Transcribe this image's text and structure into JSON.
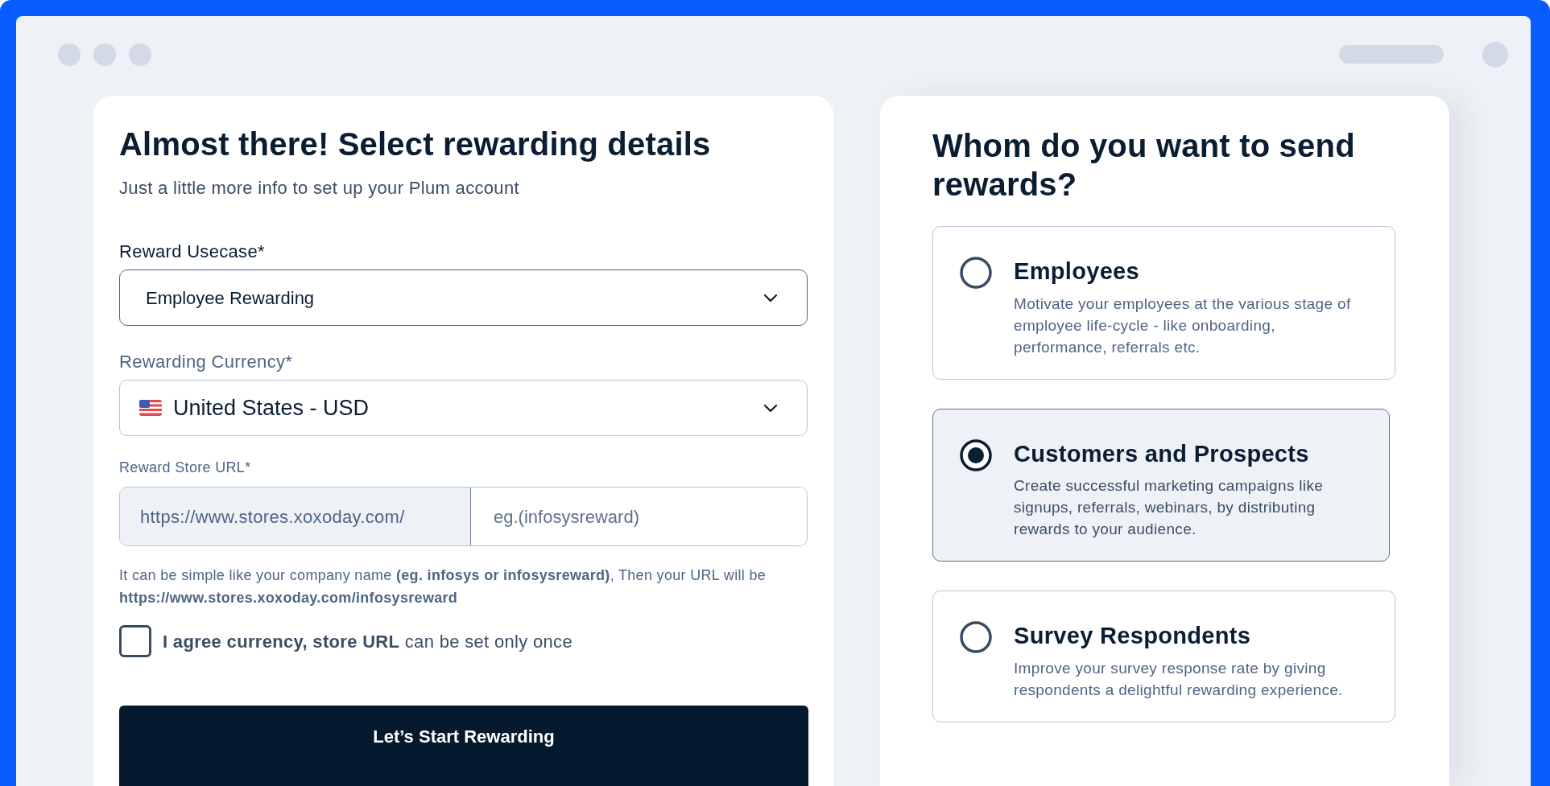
{
  "left_panel": {
    "title": "Almost there! Select rewarding details",
    "subtitle": "Just a little more info to set up your Plum account",
    "fields": [
      {
        "kind": "select",
        "label": "Reward Usecase*",
        "value": "Employee Rewarding",
        "focused": true
      },
      {
        "kind": "country-select",
        "label": "Rewarding Currency*",
        "value": "United States - USD",
        "focused": false
      },
      {
        "kind": "url",
        "label": "Reward Store URL*",
        "prefix": "https://www.stores.xoxoday.com/",
        "placeholder": "eg.(infosysreward)"
      }
    ],
    "help_text": "It can be simple like your company name **(eg. infosys or infosysreward)**, Then your URL will be **https://www.stores.xoxoday.com/infosysreward**",
    "agreement": {
      "text": "**I agree currency, store URL** can be set only once",
      "checked": false
    },
    "submit_button": "Let’s Start Rewarding"
  },
  "right_panel": {
    "title": "Whom do you want to send rewards?",
    "options": [
      {
        "title": "Employees",
        "description": "Motivate your employees at the various stage of employee life-cycle - like onboarding, performance, referrals etc.",
        "selected": false
      },
      {
        "title": "Customers and Prospects",
        "description": "Create successful marketing campaigns like signups, referrals, webinars, by distributing rewards to your audience.",
        "selected": true
      },
      {
        "title": "Survey Respondents",
        "description": "Improve your survey response rate by giving respondents a delightful rewarding experience.",
        "selected": false
      }
    ]
  }
}
